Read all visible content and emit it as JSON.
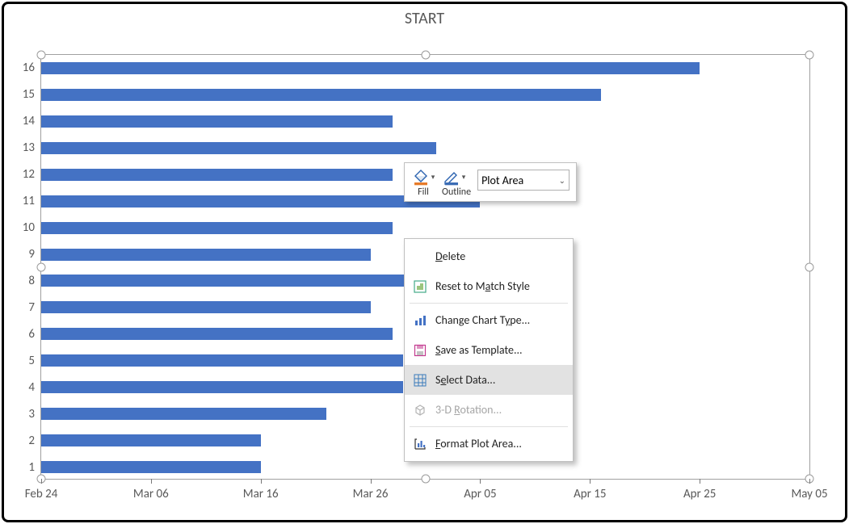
{
  "chart_data": {
    "type": "bar",
    "orientation": "horizontal",
    "title": "START",
    "xlabel": "",
    "ylabel": "",
    "x_axis": {
      "tick_labels": [
        "Feb 24",
        "Mar 06",
        "Mar 16",
        "Mar 26",
        "Apr 05",
        "Apr 15",
        "Apr 25",
        "May 05"
      ],
      "range_days": [
        0,
        70
      ]
    },
    "categories": [
      "1",
      "2",
      "3",
      "4",
      "5",
      "6",
      "7",
      "8",
      "9",
      "10",
      "11",
      "12",
      "13",
      "14",
      "15",
      "16"
    ],
    "values_days": [
      20,
      20,
      26,
      33,
      33,
      32,
      30,
      40,
      30,
      32,
      40,
      32,
      36,
      32,
      51,
      60
    ],
    "value_labels": [
      "Mar 16",
      "Mar 16",
      "Mar 22",
      "Mar 29",
      "Mar 29",
      "Mar 28",
      "Mar 26",
      "Apr 05",
      "Mar 26",
      "Mar 28",
      "Apr 05",
      "Mar 28",
      "Apr 01",
      "Mar 28",
      "Apr 16",
      "Apr 25"
    ]
  },
  "mini_toolbar": {
    "fill_label": "Fill",
    "outline_label": "Outline",
    "combo_value": "Plot Area"
  },
  "context_menu": {
    "delete": "Delete",
    "reset": "Reset to Match Style",
    "change_chart_type": "Change Chart Type...",
    "save_as_template": "Save as Template...",
    "select_data": "Select Data...",
    "rotation_3d": "3-D Rotation...",
    "format_plot_area": "Format Plot Area..."
  }
}
